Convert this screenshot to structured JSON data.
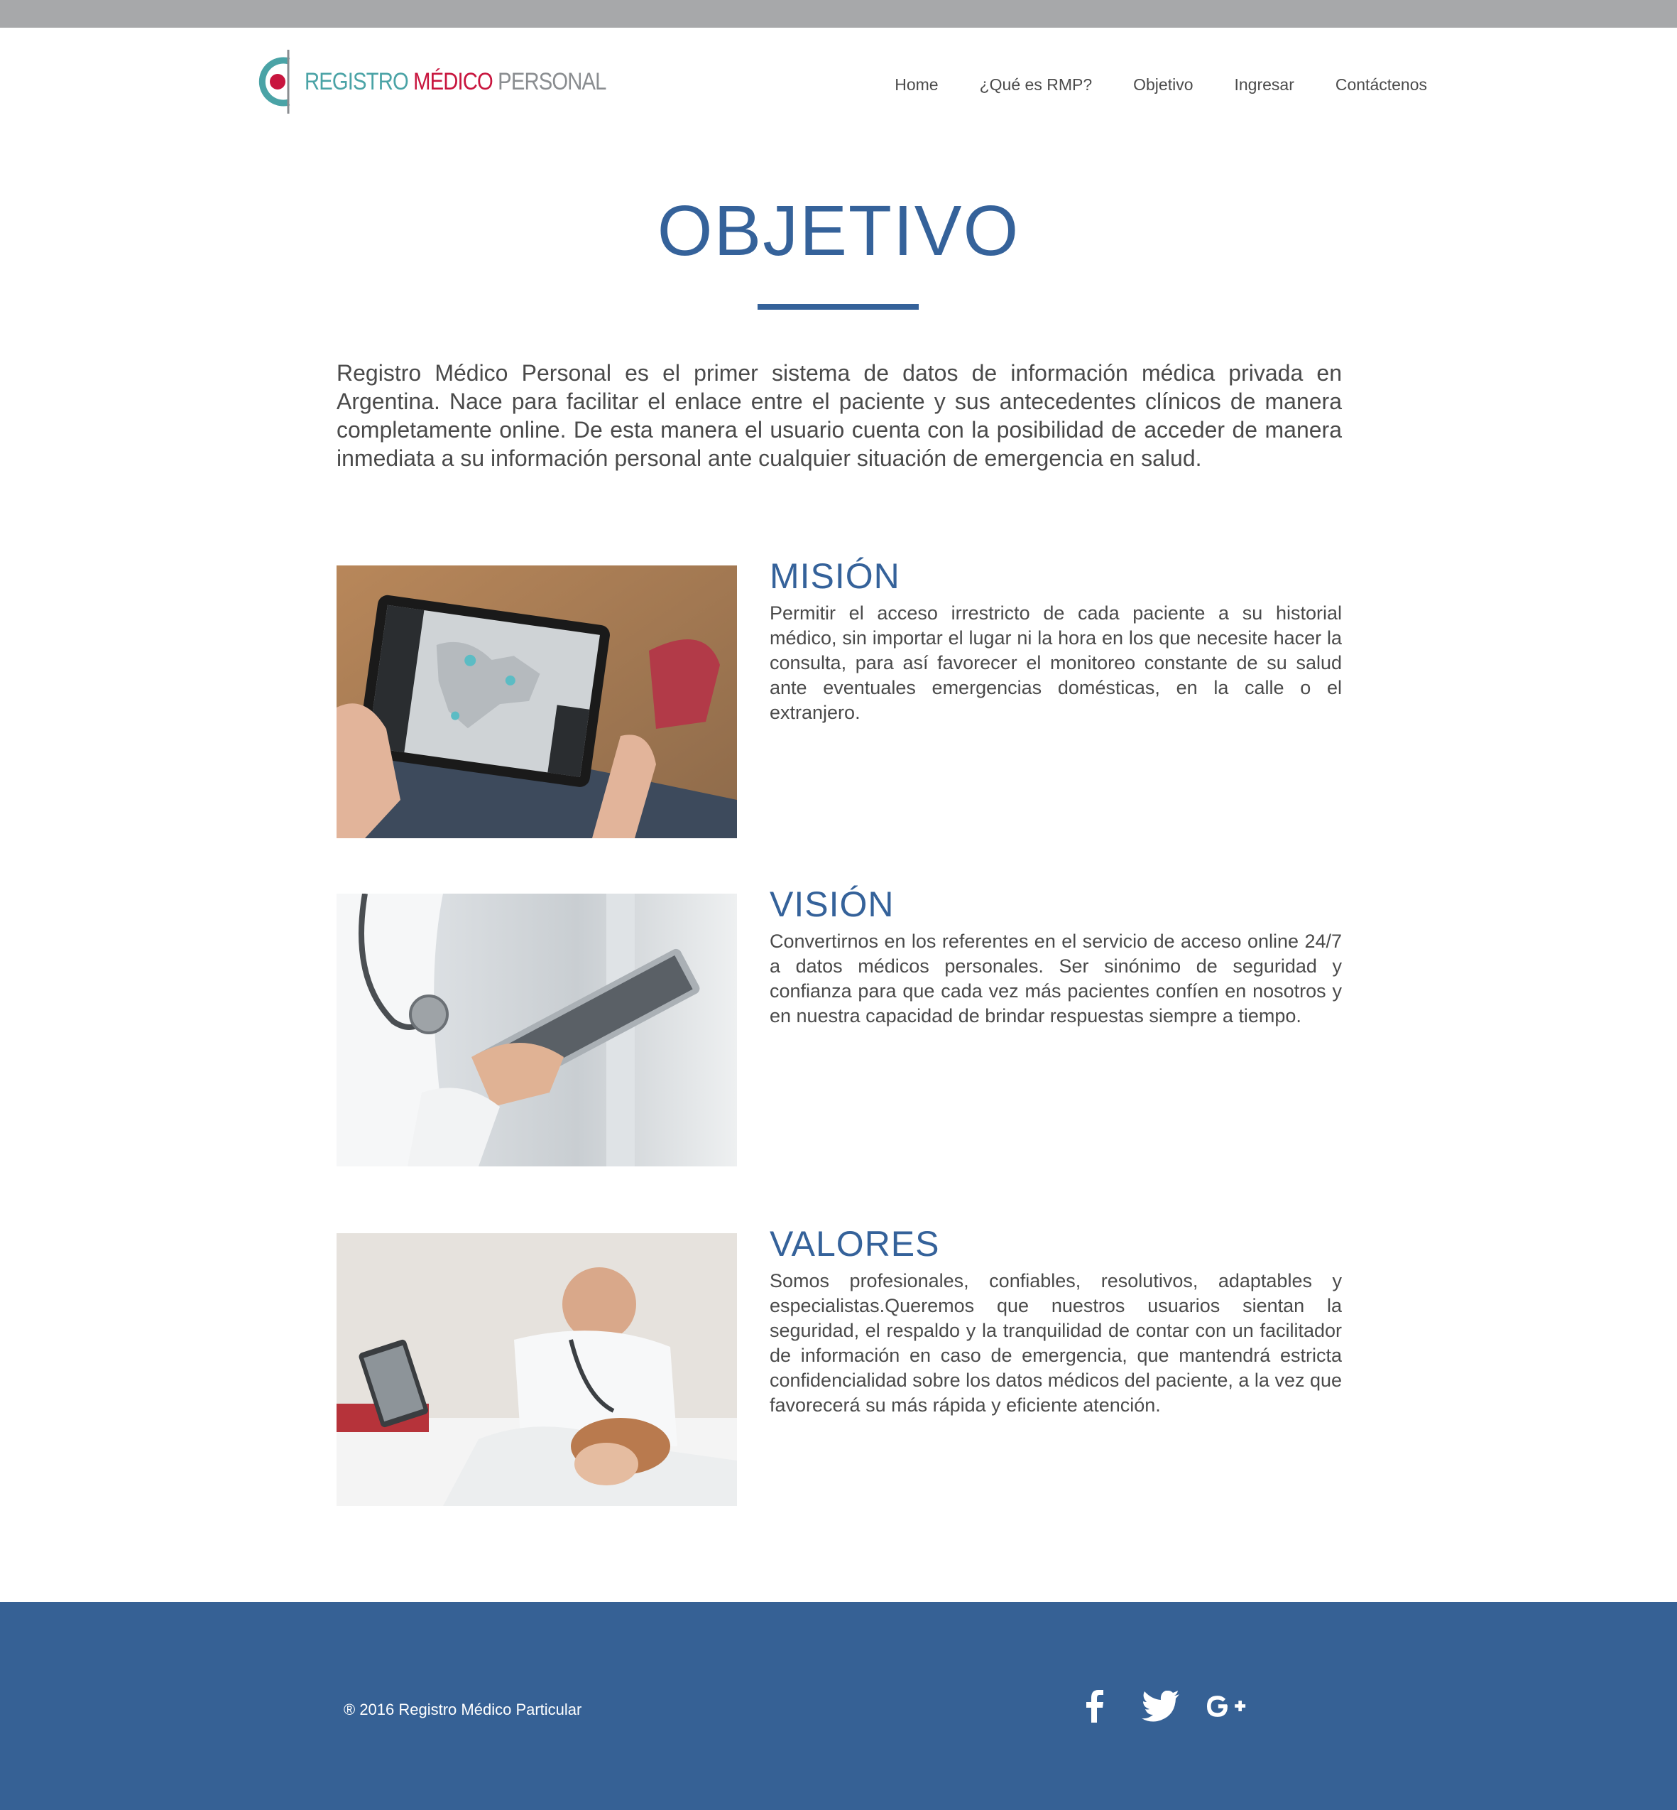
{
  "brand": {
    "word1": "REGISTRO",
    "word2": "MÉDICO",
    "word3": "PERSONAL",
    "colors": {
      "teal": "#4aa3a6",
      "red": "#c8153e",
      "gray": "#8a8d90",
      "blue": "#35629a"
    }
  },
  "nav": {
    "items": [
      {
        "label": "Home"
      },
      {
        "label": "¿Qué es RMP?"
      },
      {
        "label": "Objetivo"
      },
      {
        "label": "Ingresar"
      },
      {
        "label": "Contáctenos"
      }
    ]
  },
  "page": {
    "title": "OBJETIVO",
    "intro": "Registro Médico Personal es el primer sistema de datos de información médica privada en Argentina. Nace para facilitar el enlace entre el paciente y sus antecedentes clínicos de manera completamente online. De esta manera el usuario cuenta con la posibilidad de acceder de manera inmediata a su información personal ante cualquier situación de emergencia en salud."
  },
  "sections": [
    {
      "heading": "MISIÓN",
      "text": "Permitir el acceso irrestricto de cada paciente a su historial médico, sin importar el lugar ni la hora en los que necesite hacer la consulta, para así favorecer el monitoreo constante de su salud ante eventuales emergencias domésticas, en la calle o el extranjero.",
      "image": "tablet-map-photo"
    },
    {
      "heading": "VISIÓN",
      "text": "Convertirnos en los referentes en el servicio de acceso online 24/7 a datos médicos personales. Ser sinónimo de seguridad y confianza para que cada vez más pacientes confíen en nosotros y en nuestra capacidad de brindar respuestas siempre a tiempo.",
      "image": "doctor-tablet-photo"
    },
    {
      "heading": "VALORES",
      "text": "Somos profesionales, confiables, resolutivos, adaptables y especialistas.Queremos que nuestros usuarios sientan la seguridad, el respaldo y la tranquilidad de contar con un facilitador de información en caso de emergencia, que mantendrá estricta confidencialidad sobre los datos médicos del paciente, a la vez que favorecerá su más rápida y eficiente atención.",
      "image": "doctor-patient-photo"
    }
  ],
  "footer": {
    "copyright": "® 2016 Registro Médico Particular",
    "social": [
      {
        "icon": "facebook-icon"
      },
      {
        "icon": "twitter-icon"
      },
      {
        "icon": "google-plus-icon"
      }
    ],
    "background": "#366195"
  }
}
